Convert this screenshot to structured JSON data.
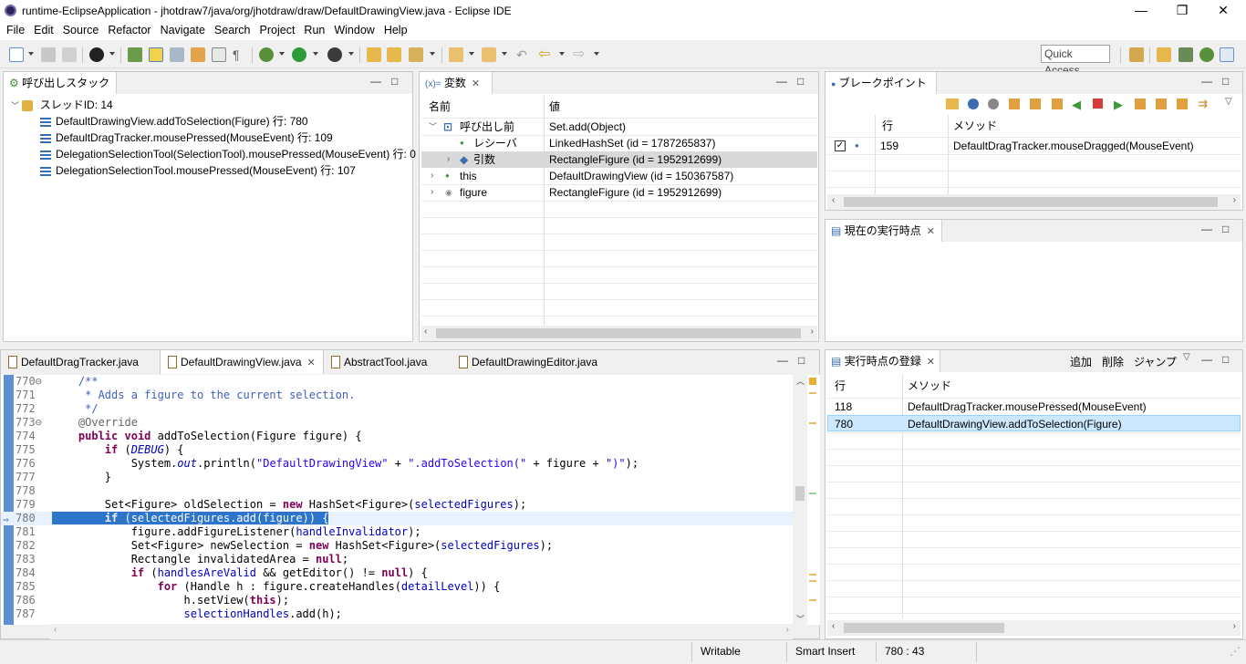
{
  "window": {
    "title": "runtime-EclipseApplication - jhotdraw7/java/org/jhotdraw/draw/DefaultDrawingView.java - Eclipse IDE",
    "minimize": "—",
    "restore": "❐",
    "close": "✕"
  },
  "menu": [
    "File",
    "Edit",
    "Source",
    "Refactor",
    "Navigate",
    "Search",
    "Project",
    "Run",
    "Window",
    "Help"
  ],
  "toolbar": {
    "quick_access": "Quick Access"
  },
  "callstack": {
    "title": "呼び出しスタック",
    "thread": "スレッドID: 14",
    "frames": [
      "DefaultDrawingView.addToSelection(Figure) 行: 780",
      "DefaultDragTracker.mousePressed(MouseEvent) 行: 109",
      "DelegationSelectionTool(SelectionTool).mousePressed(MouseEvent) 行: 0",
      "DelegationSelectionTool.mousePressed(MouseEvent) 行: 107"
    ]
  },
  "variables": {
    "title": "変数",
    "title_prefix": "(x)=",
    "col_name": "名前",
    "col_value": "値",
    "rows": [
      {
        "name": "呼び出し前",
        "value": "Set.add(Object)"
      },
      {
        "name": "レシーバ",
        "value": "LinkedHashSet (id = 1787265837)"
      },
      {
        "name": "引数",
        "value": "RectangleFigure (id = 1952912699)"
      },
      {
        "name": "this",
        "value": "DefaultDrawingView (id = 150367587)"
      },
      {
        "name": "figure",
        "value": "RectangleFigure (id = 1952912699)"
      }
    ]
  },
  "breakpoints": {
    "title": "ブレークポイント",
    "col_line": "行",
    "col_method": "メソッド",
    "rows": [
      {
        "line": "159",
        "method": "DefaultDragTracker.mouseDragged(MouseEvent)"
      }
    ]
  },
  "current_point": {
    "title": "現在の実行時点"
  },
  "history": {
    "title": "実行時点の登録",
    "add": "追加",
    "delete": "削除",
    "jump": "ジャンプ",
    "col_line": "行",
    "col_method": "メソッド",
    "rows": [
      {
        "line": "118",
        "method": "DefaultDragTracker.mousePressed(MouseEvent)"
      },
      {
        "line": "780",
        "method": "DefaultDrawingView.addToSelection(Figure)"
      }
    ]
  },
  "editor": {
    "tabs": [
      "DefaultDragTracker.java",
      "DefaultDrawingView.java",
      "AbstractTool.java",
      "DefaultDrawingEditor.java"
    ],
    "line_numbers": [
      "770⊖",
      "771",
      "772",
      "773⊖",
      "774",
      "775",
      "776",
      "777",
      "778",
      "779",
      "780",
      "781",
      "782",
      "783",
      "784",
      "785",
      "786",
      "787"
    ]
  },
  "statusbar": {
    "mode": "Writable",
    "insert": "Smart Insert",
    "position": "780 : 43"
  }
}
